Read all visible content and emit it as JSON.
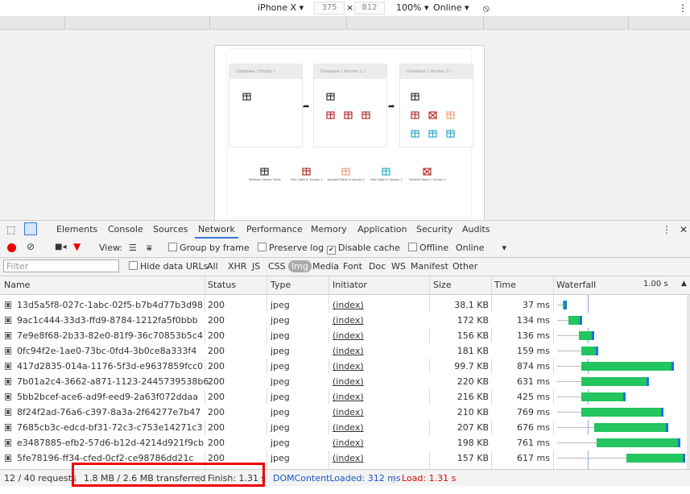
{
  "device_toolbar": {
    "device": "iPhone X",
    "width": "375",
    "times": "×",
    "height": "812",
    "zoom": "100%",
    "throttle": "Online"
  },
  "preview": {
    "panels": [
      "Database ( Empty )",
      "Database ( Version 1 )",
      "Database ( Version 2 )"
    ],
    "legend": [
      "Between Version Table",
      "New Table in Version 1",
      "Updated Table in Version 2",
      "New Table in Version 2",
      "Deleted Table in Version 2"
    ],
    "colors": {
      "dark": "#333333",
      "red": "#b03030",
      "orange": "#f0a080",
      "cyan": "#30a8c8",
      "deleted": "#c03030"
    }
  },
  "devtools": {
    "tabs": [
      "Elements",
      "Console",
      "Sources",
      "Network",
      "Performance",
      "Memory",
      "Application",
      "Security",
      "Audits"
    ],
    "active_tab": "Network",
    "toolbar": {
      "view_label": "View:",
      "group_by_frame": "Group by frame",
      "preserve_log": "Preserve log",
      "disable_cache": "Disable cache",
      "offline": "Offline",
      "online": "Online"
    },
    "filter": {
      "placeholder": "Filter",
      "hide_data_urls": "Hide data URLs",
      "types": [
        "All",
        "XHR",
        "JS",
        "CSS",
        "Img",
        "Media",
        "Font",
        "Doc",
        "WS",
        "Manifest",
        "Other"
      ],
      "active_type": "Img"
    },
    "columns": [
      "Name",
      "Status",
      "Type",
      "Initiator",
      "Size",
      "Time",
      "Waterfall"
    ],
    "waterfall_tick": "1.00 s",
    "rows": [
      {
        "name": "13d5a5f8-027c-1abc-02f5-b7b4d77b3d98",
        "status": "200",
        "type": "jpeg",
        "initiator": "(index)",
        "size": "38.1 KB",
        "time": "37 ms",
        "wait_start": 0.005,
        "start": 0.05,
        "end": 0.08
      },
      {
        "name": "9ac1c444-33d3-ffd9-8784-1212fa5f0bbb",
        "status": "200",
        "type": "jpeg",
        "initiator": "(index)",
        "size": "172 KB",
        "time": "134 ms",
        "wait_start": 0.005,
        "start": 0.09,
        "end": 0.2
      },
      {
        "name": "7e9e8f68-2b33-82e0-81f9-36c70853b5c4",
        "status": "200",
        "type": "jpeg",
        "initiator": "(index)",
        "size": "156 KB",
        "time": "136 ms",
        "wait_start": 0.005,
        "start": 0.17,
        "end": 0.29
      },
      {
        "name": "0fc94f2e-1ae0-73bc-0fd4-3b0ce8a333f4",
        "status": "200",
        "type": "jpeg",
        "initiator": "(index)",
        "size": "181 KB",
        "time": "159 ms",
        "wait_start": 0.005,
        "start": 0.19,
        "end": 0.32
      },
      {
        "name": "417d2835-014a-1176-5f3d-e9637859fcc0",
        "status": "200",
        "type": "jpeg",
        "initiator": "(index)",
        "size": "99.7 KB",
        "time": "874 ms",
        "wait_start": 0.005,
        "start": 0.19,
        "end": 0.9
      },
      {
        "name": "7b01a2c4-3662-a871-1123-2445739538b6",
        "status": "200",
        "type": "jpeg",
        "initiator": "(index)",
        "size": "220 KB",
        "time": "631 ms",
        "wait_start": 0.005,
        "start": 0.19,
        "end": 0.71
      },
      {
        "name": "5bb2bcef-ace6-ad9f-eed9-2a63f072ddaa",
        "status": "200",
        "type": "jpeg",
        "initiator": "(index)",
        "size": "216 KB",
        "time": "425 ms",
        "wait_start": 0.005,
        "start": 0.19,
        "end": 0.53
      },
      {
        "name": "8f24f2ad-76a6-c397-8a3a-2f64277e7b47",
        "status": "200",
        "type": "jpeg",
        "initiator": "(index)",
        "size": "210 KB",
        "time": "769 ms",
        "wait_start": 0.005,
        "start": 0.19,
        "end": 0.82
      },
      {
        "name": "7685cb3c-edcd-bf31-72c3-c753e14271c3",
        "status": "200",
        "type": "jpeg",
        "initiator": "(index)",
        "size": "207 KB",
        "time": "676 ms",
        "wait_start": 0.005,
        "start": 0.29,
        "end": 0.86
      },
      {
        "name": "e3487885-efb2-57d6-b12d-4214d921f9cb",
        "status": "200",
        "type": "jpeg",
        "initiator": "(index)",
        "size": "198 KB",
        "time": "761 ms",
        "wait_start": 0.005,
        "start": 0.31,
        "end": 0.95
      },
      {
        "name": "5fe78196-ff34-cfed-0cf2-ce98786dd21c",
        "status": "200",
        "type": "jpeg",
        "initiator": "(index)",
        "size": "157 KB",
        "time": "617 ms",
        "wait_start": 0.005,
        "start": 0.54,
        "end": 0.99
      }
    ],
    "status_bar": {
      "requests": "12 / 40 requests",
      "transferred": "1.8 MB / 2.6 MB transferred",
      "finish": "Finish: 1.31 s",
      "dom_content_loaded": "DOMContentLoaded: 312 ms",
      "load": "Load: 1.31 s"
    }
  }
}
